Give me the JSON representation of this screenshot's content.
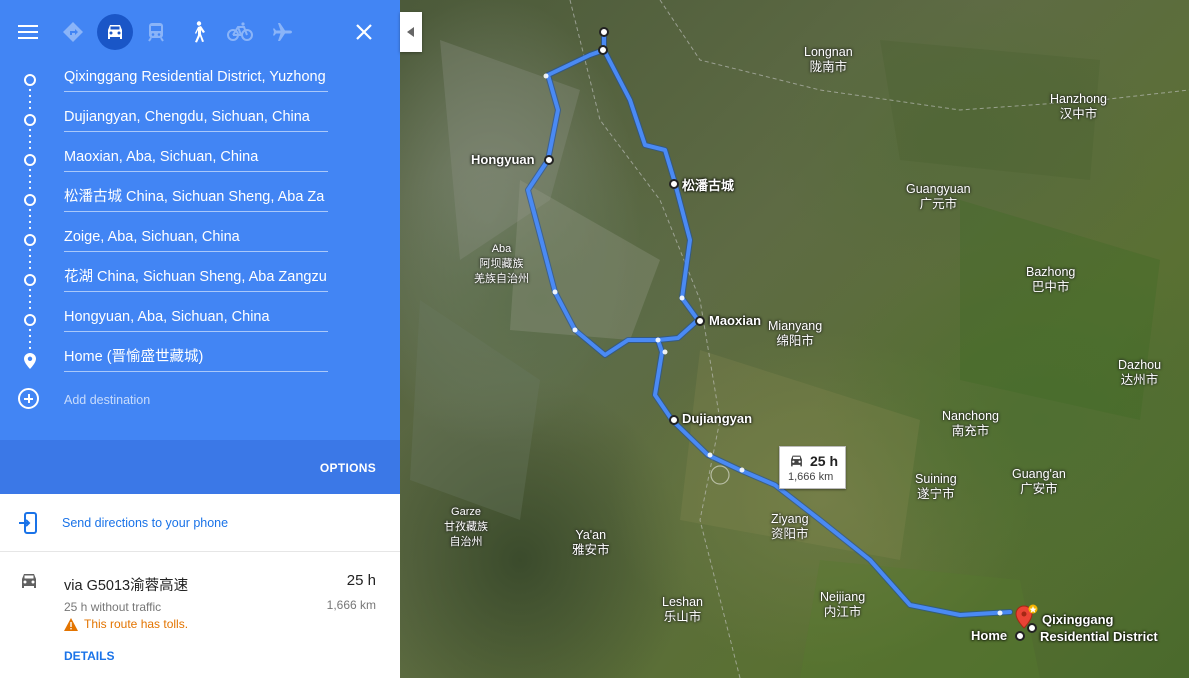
{
  "panel": {
    "waypoints": [
      {
        "label": "Qixinggang Residential District, Yuzhong"
      },
      {
        "label": "Dujiangyan, Chengdu, Sichuan, China"
      },
      {
        "label": "Maoxian, Aba, Sichuan, China"
      },
      {
        "label": "松潘古城 China, Sichuan Sheng, Aba Za"
      },
      {
        "label": "Zoige, Aba, Sichuan, China"
      },
      {
        "label": "花湖 China, Sichuan Sheng, Aba Zangzu"
      },
      {
        "label": "Hongyuan, Aba, Sichuan, China"
      },
      {
        "label": "Home (晋愉盛世藏城)"
      }
    ],
    "add_destination": "Add destination",
    "options_label": "OPTIONS",
    "send_label": "Send directions to your phone",
    "route": {
      "via": "via G5013渝蓉高速",
      "time": "25 h",
      "traffic": "25 h without traffic",
      "distance": "1,666 km",
      "tolls": "This route has tolls.",
      "details": "DETAILS"
    },
    "colors": {
      "header": "#4285f4",
      "options_bar": "#3b78e7",
      "link": "#1a73e8",
      "warning": "#e37400"
    },
    "icons": [
      "menu-icon",
      "directions-icon",
      "car-icon",
      "transit-icon",
      "walk-icon",
      "bicycle-icon",
      "flight-icon",
      "close-icon",
      "send-to-phone-icon",
      "car-icon",
      "warning-icon",
      "add-circle-icon",
      "place-pin-icon"
    ]
  },
  "map": {
    "route_box": {
      "time": "25 h",
      "distance": "1,666 km"
    },
    "stop_labels": {
      "hongyuan": "Hongyuan",
      "songpan": "松潘古城",
      "maoxian": "Maoxian",
      "dujiangyan": "Dujiangyan",
      "home": "Home",
      "qixinggang_1": "Qixinggang",
      "qixinggang_2": "Residential District"
    },
    "cities": {
      "longnan_en": "Longnan",
      "longnan_zh": "陇南市",
      "hanzhong_en": "Hanzhong",
      "hanzhong_zh": "汉中市",
      "guangyuan_en": "Guangyuan",
      "guangyuan_zh": "广元市",
      "aba_en": "Aba",
      "aba_zh1": "阿坝藏族",
      "aba_zh2": "羌族自治州",
      "bazhong_en": "Bazhong",
      "bazhong_zh": "巴中市",
      "mianyang_en": "Mianyang",
      "mianyang_zh": "绵阳市",
      "dazhou_en": "Dazhou",
      "dazhou_zh": "达州市",
      "nanchong_en": "Nanchong",
      "nanchong_zh": "南充市",
      "suining_en": "Suining",
      "suining_zh": "遂宁市",
      "guangan_en": "Guang'an",
      "guangan_zh": "广安市",
      "garze_en": "Garze",
      "garze_zh1": "甘孜藏族",
      "garze_zh2": "自治州",
      "yaan_en": "Ya'an",
      "yaan_zh": "雅安市",
      "ziyang_en": "Ziyang",
      "ziyang_zh": "资阳市",
      "neijiang_en": "Neijiang",
      "neijiang_zh": "内江市",
      "leshan_en": "Leshan",
      "leshan_zh": "乐山市"
    },
    "route_color": "#4a8af4"
  }
}
